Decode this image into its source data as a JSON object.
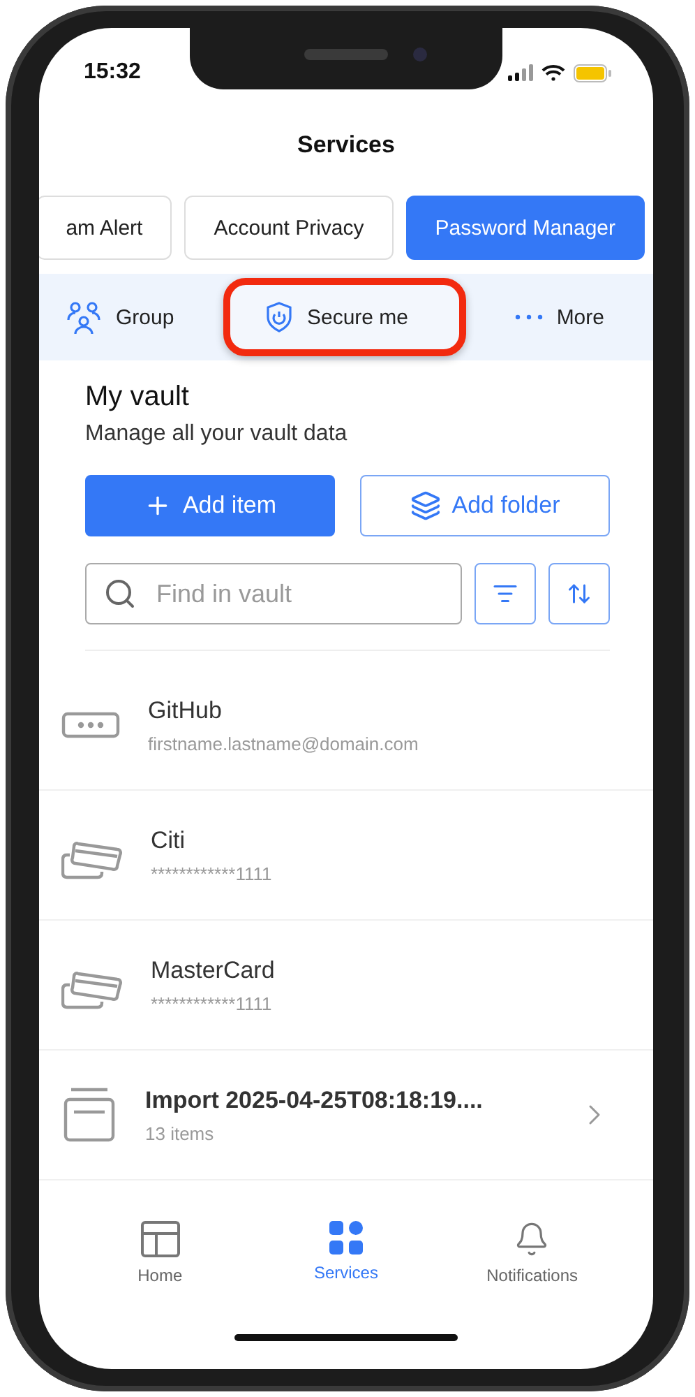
{
  "status_bar": {
    "time": "15:32"
  },
  "header": {
    "title": "Services"
  },
  "service_tabs": [
    {
      "label": "am Alert",
      "selected": false
    },
    {
      "label": "Account Privacy",
      "selected": false
    },
    {
      "label": "Password Manager",
      "selected": true
    }
  ],
  "menu": [
    {
      "kind": "group",
      "label": "Group",
      "highlighted": false
    },
    {
      "kind": "shield",
      "label": "Secure me",
      "highlighted": true
    },
    {
      "kind": "more",
      "label": "More",
      "highlighted": false
    }
  ],
  "vault": {
    "title": "My vault",
    "subtitle": "Manage all your vault data",
    "add_item": "Add item",
    "add_folder": "Add folder",
    "search": {
      "placeholder": "Find in vault"
    }
  },
  "items": [
    {
      "kind": "login",
      "name": "GitHub",
      "detail": "firstname.lastname@domain.com"
    },
    {
      "kind": "card",
      "name": "Citi",
      "detail": "************1111"
    },
    {
      "kind": "card",
      "name": "MasterCard",
      "detail": "************1111"
    },
    {
      "kind": "folder",
      "name": "Import 2025-04-25T08:18:19....",
      "detail": "13 items"
    }
  ],
  "bottom_nav": [
    {
      "kind": "home",
      "label": "Home",
      "selected": false
    },
    {
      "kind": "services",
      "label": "Services",
      "selected": true
    },
    {
      "kind": "bell",
      "label": "Notifications",
      "selected": false
    }
  ]
}
